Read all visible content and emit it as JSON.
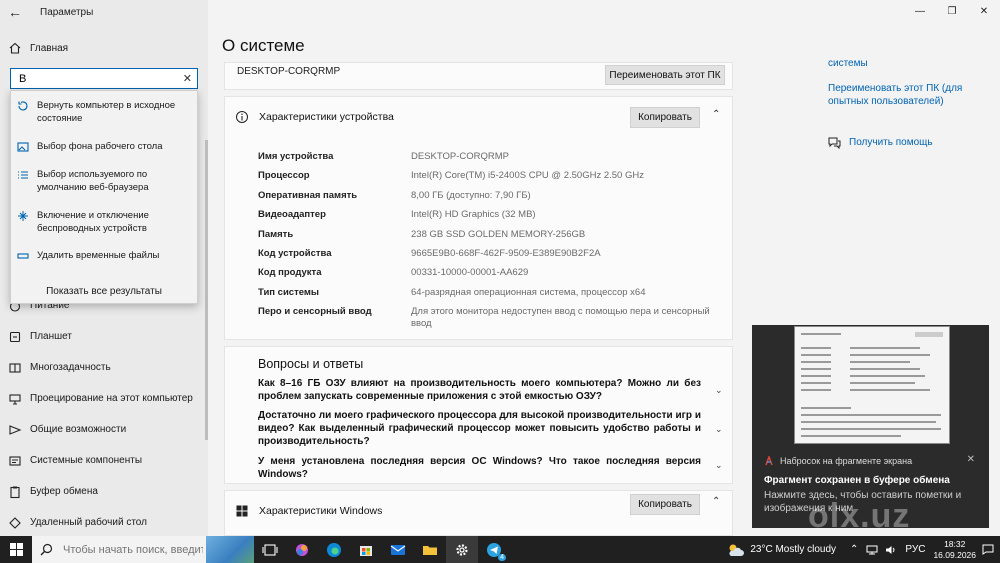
{
  "window": {
    "title": "Параметры",
    "minimize": "—",
    "maximize": "❐",
    "close": "✕"
  },
  "sidebar": {
    "home": "Главная",
    "search_value": "В",
    "items": [
      {
        "label": "Питание",
        "icon": "power-icon"
      },
      {
        "label": "Планшет",
        "icon": "tablet-icon"
      },
      {
        "label": "Многозадачность",
        "icon": "multitasking-icon"
      },
      {
        "label": "Проецирование на этот компьютер",
        "icon": "projecting-icon"
      },
      {
        "label": "Общие возможности",
        "icon": "shared-experiences-icon"
      },
      {
        "label": "Системные компоненты",
        "icon": "system-components-icon"
      },
      {
        "label": "Буфер обмена",
        "icon": "clipboard-icon"
      },
      {
        "label": "Удаленный рабочий стол",
        "icon": "remote-desktop-icon"
      }
    ]
  },
  "search_results": {
    "items": [
      {
        "label": "Вернуть компьютер в исходное состояние",
        "icon": "reset-icon"
      },
      {
        "label": "Выбор фона рабочего стола",
        "icon": "background-icon"
      },
      {
        "label": "Выбор используемого по умолчанию веб-браузера",
        "icon": "list-icon"
      },
      {
        "label": "Включение и отключение беспроводных устройств",
        "icon": "wireless-icon"
      },
      {
        "label": "Удалить временные файлы",
        "icon": "storage-icon"
      }
    ],
    "show_all": "Показать все результаты"
  },
  "main": {
    "title": "О системе",
    "pc_name": "DESKTOP-CORQRMP",
    "rename_button": "Переименовать этот ПК",
    "device_section": {
      "title": "Характеристики устройства",
      "copy_button": "Копировать",
      "specs": [
        {
          "key": "Имя устройства",
          "value": "DESKTOP-CORQRMP"
        },
        {
          "key": "Процессор",
          "value": "Intel(R) Core(TM) i5-2400S CPU @ 2.50GHz   2.50 GHz"
        },
        {
          "key": "Оперативная память",
          "value": "8,00 ГБ (доступно: 7,90 ГБ)"
        },
        {
          "key": "Видеоадаптер",
          "value": "Intel(R) HD Graphics (32 MB)"
        },
        {
          "key": "Память",
          "value": "238 GB SSD GOLDEN MEMORY-256GB"
        },
        {
          "key": "Код устройства",
          "value": "9665E9B0-668F-462F-9509-E389E90B2F2A"
        },
        {
          "key": "Код продукта",
          "value": "00331-10000-00001-AA629"
        },
        {
          "key": "Тип системы",
          "value": "64-разрядная операционная система, процессор x64"
        },
        {
          "key": "Перо и сенсорный ввод",
          "value": "Для этого монитора недоступен ввод с помощью пера и сенсорный ввод"
        }
      ]
    },
    "qa_section": {
      "title": "Вопросы и ответы",
      "items": [
        "Как 8–16 ГБ ОЗУ влияют на производительность моего компьютера? Можно ли без проблем запускать современные приложения с этой емкостью ОЗУ?",
        "Достаточно ли моего графического процессора для высокой производительности игр и видео? Как выделенный графический процессор может повысить удобство работы и производительность?",
        "У меня установлена последняя версия ОС Windows? Что такое последняя версия Windows?"
      ]
    },
    "windows_section": {
      "title": "Характеристики Windows",
      "copy_button": "Копировать"
    }
  },
  "right_panel": {
    "link_partial": "системы",
    "rename_advanced": "Переименовать этот ПК (для опытных пользователей)",
    "get_help": "Получить помощь"
  },
  "notification": {
    "app": "Набросок на фрагменте экрана",
    "title": "Фрагмент сохранен в буфере обмена",
    "body": "Нажмите здесь, чтобы оставить пометки и изображения к ним"
  },
  "watermark": "olx.uz",
  "taskbar": {
    "search_placeholder": "Чтобы начать поиск, введите",
    "weather": "23°C  Mostly cloudy",
    "language": "РУС",
    "time": "18:32",
    "date": "16.09.2026",
    "telegram_badge": "4"
  },
  "colors": {
    "accent": "#0063b1",
    "taskbar": "#202020",
    "notification_bg": "#2b2b2b"
  }
}
